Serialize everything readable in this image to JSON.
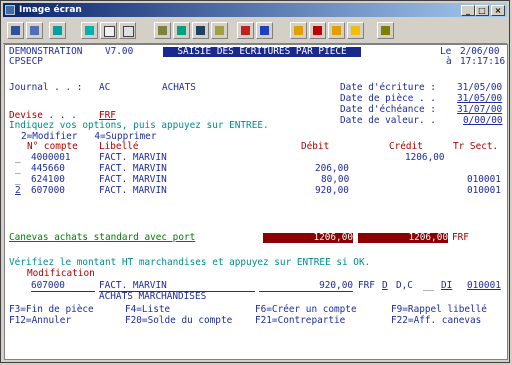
{
  "window": {
    "title": "Image écran",
    "btn_min": "_",
    "btn_max": "□",
    "btn_close": "×"
  },
  "toolbar": {
    "icons": [
      "print-screen-icon",
      "print-icon",
      "host-icon",
      "copy-icon",
      "paste-icon",
      "edit-icon",
      "macro-icon",
      "keyboard-icon",
      "color-icon",
      "transfer-icon",
      "send-icon",
      "receive-icon",
      "disconnect-icon",
      "connect-icon",
      "exit-icon"
    ]
  },
  "screen": {
    "company": "DEMONSTRATION",
    "version": "V7.00",
    "program": "CPSECP",
    "header_title": "SAISIE DES ECRITURES PAR PIECE",
    "date_label": "Le",
    "date": "2/06/00",
    "time_label": "à",
    "time": "17:17:16",
    "journal_label": "Journal . . :",
    "journal_code": "AC",
    "journal_name": "ACHATS",
    "date_ecriture_label": "Date d'écriture :",
    "date_ecriture": "31/05/00",
    "date_piece_label": "Date de pièce . .",
    "date_piece": "31/05/00",
    "date_echeance_label": "Date d'échéance :",
    "date_echeance": "31/07/00",
    "date_valeur_label": "Date de valeur. .",
    "date_valeur": "0/00/00",
    "devise_label": "Devise . . .",
    "devise": "FRF",
    "instructions": "Indiquez vos options, puis appuyez sur ENTREE.",
    "options": "2=Modifier   4=Supprimer",
    "columns": {
      "compte": "N° compte",
      "libelle": "Libellé",
      "debit": "Débit",
      "credit": "Crédit",
      "sect": "Tr Sect."
    },
    "rows": [
      {
        "opt": "_",
        "compte": "4000001",
        "libelle": "FACT. MARVIN",
        "debit": "",
        "credit": "1206,00",
        "sect": ""
      },
      {
        "opt": "_",
        "compte": "445660",
        "libelle": "FACT. MARVIN",
        "debit": "206,00",
        "credit": "",
        "sect": ""
      },
      {
        "opt": "_",
        "compte": "624100",
        "libelle": "FACT. MARVIN",
        "debit": "80,00",
        "credit": "",
        "sect": "010001"
      },
      {
        "opt": "2",
        "compte": "607000",
        "libelle": "FACT. MARVIN",
        "debit": "920,00",
        "credit": "",
        "sect": "010001"
      }
    ],
    "canevas": "Canevas achats standard avec port",
    "total_debit": "1206,00",
    "total_credit": "1206,00",
    "total_currency": "FRF",
    "message": "Vérifiez le montant HT marchandises et appuyez sur ENTREE si OK.",
    "modif_label": "Modification",
    "modif": {
      "compte": "607000",
      "libelle": "FACT. MARVIN",
      "montant": "920,00",
      "devise": "FRF",
      "sens": "D",
      "dc": "D,C",
      "blank": "__",
      "code": "DI",
      "sect": "010001"
    },
    "modif_sublabel": "ACHATS MARCHANDISES",
    "fkeys": {
      "f3": "F3=Fin de pièce",
      "f4": "F4=Liste",
      "f6": "F6=Créer un compte",
      "f9": "F9=Rappel libellé",
      "f12": "F12=Annuler",
      "f20": "F20=Solde du compte",
      "f21": "F21=Contrepartie",
      "f22": "F22=Aff. canevas"
    }
  }
}
